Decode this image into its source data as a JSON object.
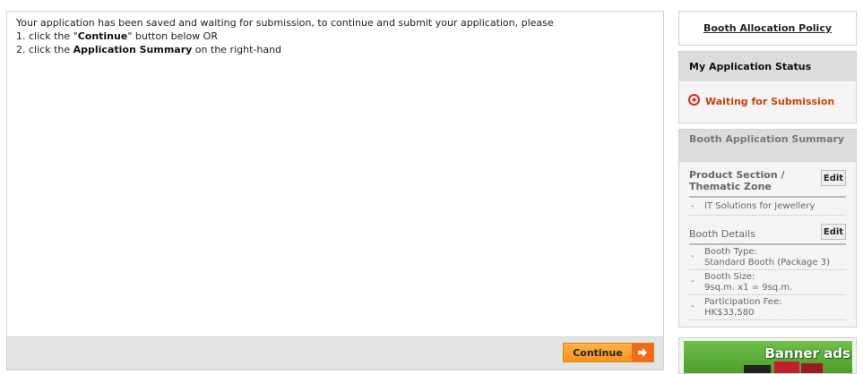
{
  "message": {
    "line1": "Your application has been saved and waiting for submission, to continue and submit your application, please",
    "line2_pre": "1. click the \"",
    "line2_bold": "Continue",
    "line2_post": "\" button below OR",
    "line3_pre": "2. click the ",
    "line3_bold": "Application Summary",
    "line3_post": " on the right-hand"
  },
  "footer": {
    "continue_label": "Continue"
  },
  "sidebar": {
    "policy_link": "Booth Allocation Policy",
    "status": {
      "title": "My Application Status",
      "value": "Waiting for Submission"
    },
    "summary": {
      "title": "Booth Application Summary",
      "product_section": {
        "title": "Product Section / Thematic Zone",
        "edit": "Edit",
        "items": [
          "IT Solutions for Jewellery"
        ]
      },
      "booth_details": {
        "title": "Booth Details",
        "edit": "Edit",
        "items": [
          {
            "label": "Booth Type:",
            "value": "Standard Booth (Package 3)"
          },
          {
            "label": "Booth Size:",
            "value": "9sq.m. x1 = 9sq.m."
          },
          {
            "label": "Participation Fee:",
            "value": "HK$33,580"
          }
        ]
      }
    },
    "banner": {
      "text": "Banner ads"
    }
  },
  "colors": {
    "accent_orange": "#f7931e",
    "status_red": "#c9400e",
    "banner_green": "#4c9a2a"
  }
}
